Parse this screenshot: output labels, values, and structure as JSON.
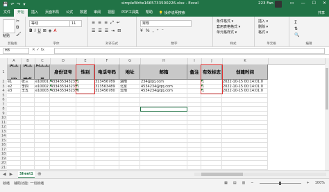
{
  "titlebar": {
    "qat": [
      "💾",
      "↶",
      "↷",
      "▾"
    ],
    "title": "simpleWrite1665733500226.xlsx  -  Excel",
    "user": "223 Fan",
    "controls": [
      "▭",
      "—",
      "☐",
      "✕"
    ]
  },
  "tabs": [
    "文件",
    "开始",
    "插入",
    "页面布局",
    "公式",
    "数据",
    "审阅",
    "视图",
    "PDF工具集",
    "帮助"
  ],
  "active_tab_index": 1,
  "tellme": "💡 操作说明搜索",
  "share": "共享",
  "ribbon": {
    "clipboard": {
      "paste": "粘贴",
      "label": "剪贴板"
    },
    "font": {
      "name": "等线",
      "size": "11",
      "buttons": [
        "B",
        "I",
        "U",
        "A",
        "A"
      ],
      "label": "字体"
    },
    "alignment": {
      "label": "对齐方式"
    },
    "number": {
      "format": "常规",
      "label": "数字"
    },
    "styles": {
      "items": [
        "条件格式 ▾",
        "套用表格格式 ▾",
        "单元格样式 ▾"
      ],
      "label": "样式"
    },
    "cells": {
      "items": [
        "插入 ▾",
        "删除 ▾",
        "格式 ▾"
      ],
      "label": "单元格"
    },
    "editing": {
      "label": "编辑"
    }
  },
  "formula_bar": {
    "namebox": "H8",
    "fx": "✕ ✓ fx",
    "value": ""
  },
  "columns": [
    "A",
    "B",
    "C",
    "D",
    "E",
    "F",
    "G",
    "H",
    "I",
    "J",
    "K"
  ],
  "rows": [
    "1",
    "2",
    "3",
    "4",
    "5",
    "6",
    "7",
    "8",
    "9",
    "10",
    "11",
    "12",
    "13",
    "14",
    "15",
    "16",
    "17",
    "18",
    "19",
    "20",
    "21"
  ],
  "headers": [
    "员工ID",
    "员工姓名",
    "员工工号",
    "身份证号",
    "性别",
    "电话号码",
    "地址",
    "邮箱",
    "备注",
    "有效标志",
    "创建时间"
  ],
  "data_rows": [
    [
      "e1",
      "张三",
      "e10001",
      "433435343235",
      "1",
      "313456789",
      "湖南",
      "234@qq.com",
      "",
      "1",
      "2022-10-15 00:14:01.0"
    ],
    [
      "e2",
      "李四",
      "e10002",
      "433435343235",
      "1",
      "313563489",
      "北京",
      "4534234@qq.com",
      "",
      "1",
      "2022-10-15 00:14:01.0"
    ],
    [
      "e3",
      "王五",
      "e10003",
      "433435343235",
      "0",
      "313456780",
      "云南",
      "4534234@qq.com",
      "",
      "1",
      "2022-10-15 00:14:01.0"
    ]
  ],
  "sheet": {
    "nav": [
      "◀",
      "▶"
    ],
    "tab": "Sheet1",
    "add": "⊕"
  },
  "status": {
    "left": [
      "就绪",
      "辅助功能: 一切就绪"
    ],
    "zoom": "100%",
    "views": [
      "▦",
      "▤",
      "▥"
    ]
  },
  "colors": {
    "excel_green": "#217346",
    "header_gray": "#c8c8c8",
    "highlight_red": "#e03030"
  }
}
